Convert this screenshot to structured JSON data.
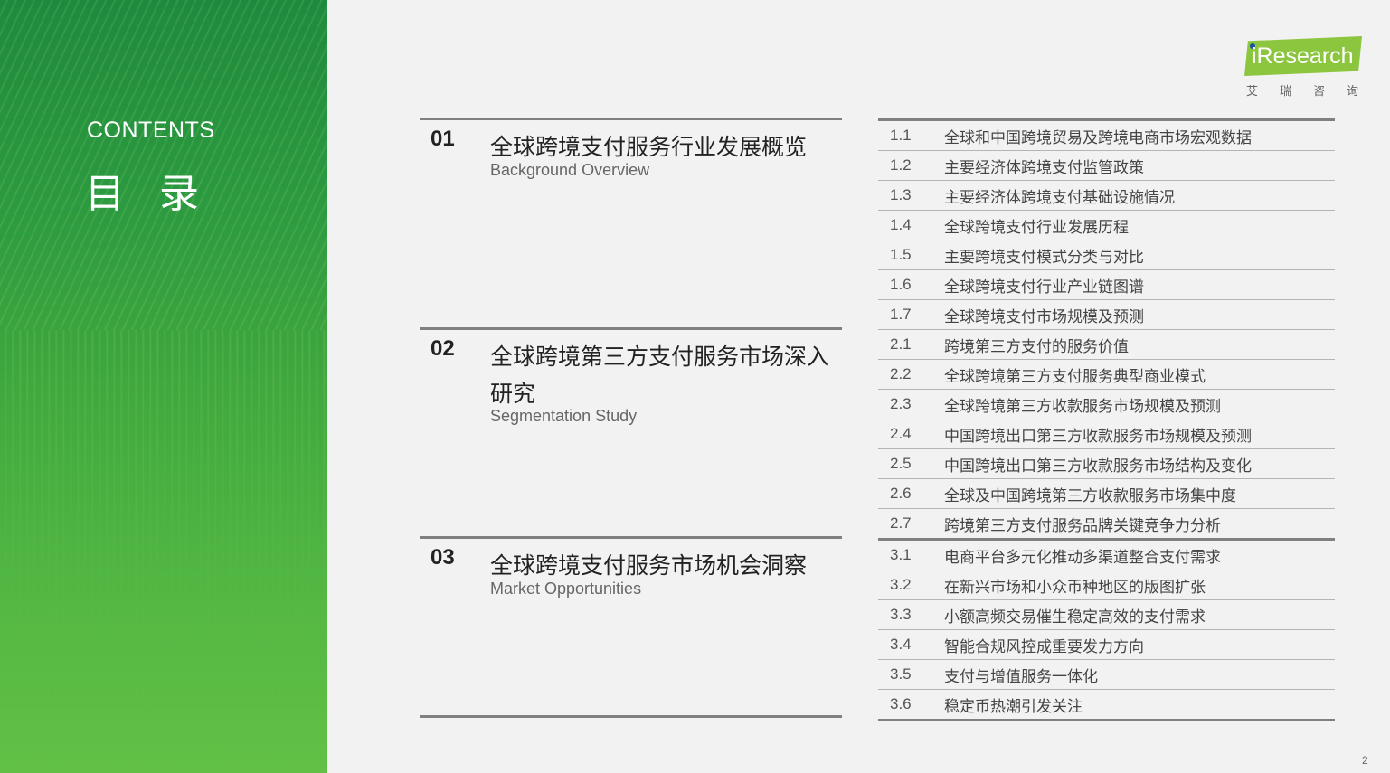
{
  "sidebar": {
    "contents_en": "CONTENTS",
    "contents_cn": "目 录"
  },
  "logo": {
    "word": "iResearch",
    "cn": "艾瑞咨询"
  },
  "sections": [
    {
      "num": "01",
      "title": "全球跨境支付服务行业发展概览",
      "subtitle": "Background Overview"
    },
    {
      "num": "02",
      "title": "全球跨境第三方支付服务市场深入研究",
      "subtitle": "Segmentation Study"
    },
    {
      "num": "03",
      "title": "全球跨境支付服务市场机会洞察",
      "subtitle": "Market Opportunities"
    }
  ],
  "toc": [
    {
      "num": "1.1",
      "title": "全球和中国跨境贸易及跨境电商市场宏观数据"
    },
    {
      "num": "1.2",
      "title": "主要经济体跨境支付监管政策"
    },
    {
      "num": "1.3",
      "title": "主要经济体跨境支付基础设施情况"
    },
    {
      "num": "1.4",
      "title": "全球跨境支付行业发展历程"
    },
    {
      "num": "1.5",
      "title": "主要跨境支付模式分类与对比"
    },
    {
      "num": "1.6",
      "title": "全球跨境支付行业产业链图谱"
    },
    {
      "num": "1.7",
      "title": "全球跨境支付市场规模及预测"
    },
    {
      "num": "2.1",
      "title": "跨境第三方支付的服务价值"
    },
    {
      "num": "2.2",
      "title": "全球跨境第三方支付服务典型商业模式"
    },
    {
      "num": "2.3",
      "title": "全球跨境第三方收款服务市场规模及预测"
    },
    {
      "num": "2.4",
      "title": "中国跨境出口第三方收款服务市场规模及预测"
    },
    {
      "num": "2.5",
      "title": "中国跨境出口第三方收款服务市场结构及变化"
    },
    {
      "num": "2.6",
      "title": "全球及中国跨境第三方收款服务市场集中度"
    },
    {
      "num": "2.7",
      "title": "跨境第三方支付服务品牌关键竞争力分析"
    },
    {
      "num": "3.1",
      "title": "电商平台多元化推动多渠道整合支付需求"
    },
    {
      "num": "3.2",
      "title": "在新兴市场和小众币种地区的版图扩张"
    },
    {
      "num": "3.3",
      "title": "小额高频交易催生稳定高效的支付需求"
    },
    {
      "num": "3.4",
      "title": "智能合规风控成重要发力方向"
    },
    {
      "num": "3.5",
      "title": "支付与增值服务一体化"
    },
    {
      "num": "3.6",
      "title": "稳定币热潮引发关注"
    }
  ],
  "page_number": "2"
}
